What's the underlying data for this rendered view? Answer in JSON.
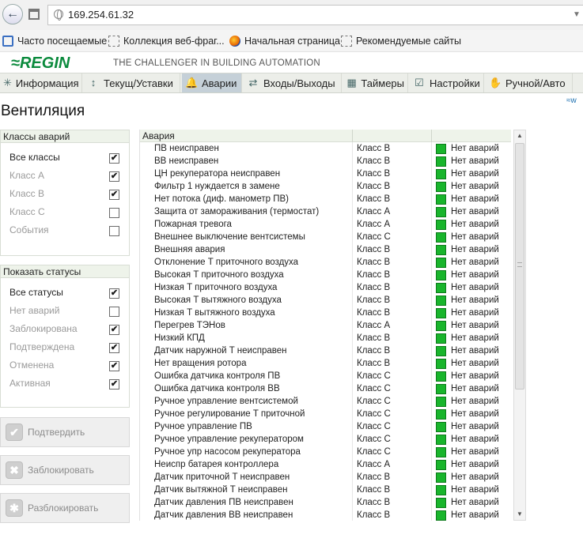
{
  "browser": {
    "url": "169.254.61.32",
    "bookmarks": [
      "Часто посещаемые",
      "Коллекция веб-фраг...",
      "Начальная страница",
      "Рекомендуемые сайты"
    ]
  },
  "app": {
    "logo": "REGIN",
    "tagline": "THE CHALLENGER IN BUILDING AUTOMATION",
    "corner_link": "w"
  },
  "menu": [
    {
      "label": "Информация",
      "icon": "snowflake-icon",
      "active": false
    },
    {
      "label": "Текущ/Уставки",
      "icon": "chart-icon",
      "active": false
    },
    {
      "label": "Аварии",
      "icon": "bell-icon",
      "active": true
    },
    {
      "label": "Входы/Выходы",
      "icon": "arrows-icon",
      "active": false
    },
    {
      "label": "Таймеры",
      "icon": "calendar-icon",
      "active": false
    },
    {
      "label": "Настройки",
      "icon": "checklist-icon",
      "active": false
    },
    {
      "label": "Ручной/Авто",
      "icon": "hand-icon",
      "active": false
    }
  ],
  "page_title": "Вентиляция",
  "alarm_classes": {
    "title": "Классы аварий",
    "options": [
      {
        "label": "Все классы",
        "checked": true,
        "dim": false
      },
      {
        "label": "Класс A",
        "checked": true,
        "dim": true
      },
      {
        "label": "Класс B",
        "checked": true,
        "dim": true
      },
      {
        "label": "Класс C",
        "checked": false,
        "dim": true
      },
      {
        "label": "События",
        "checked": false,
        "dim": true
      }
    ]
  },
  "statuses": {
    "title": "Показать статусы",
    "options": [
      {
        "label": "Все статусы",
        "checked": true,
        "dim": false
      },
      {
        "label": "Нет аварий",
        "checked": false,
        "dim": true
      },
      {
        "label": "Заблокирована",
        "checked": true,
        "dim": true
      },
      {
        "label": "Подтверждена",
        "checked": true,
        "dim": true
      },
      {
        "label": "Отменена",
        "checked": true,
        "dim": true
      },
      {
        "label": "Активная",
        "checked": true,
        "dim": true
      }
    ]
  },
  "actions": [
    {
      "label": "Подтвердить",
      "icon": "check-icon"
    },
    {
      "label": "Заблокировать",
      "icon": "block-icon"
    },
    {
      "label": "Разблокировать",
      "icon": "unblock-icon"
    }
  ],
  "table": {
    "header": "Авария",
    "status_color": "#19b52c",
    "rows": [
      {
        "name": "ПВ неисправен",
        "class": "Класс B",
        "status": "Нет аварий"
      },
      {
        "name": "ВВ неисправен",
        "class": "Класс B",
        "status": "Нет аварий"
      },
      {
        "name": "ЦН рекуператора неисправен",
        "class": "Класс B",
        "status": "Нет аварий"
      },
      {
        "name": "Фильтр 1 нуждается в замене",
        "class": "Класс B",
        "status": "Нет аварий"
      },
      {
        "name": "Нет потока (диф. манометр ПВ)",
        "class": "Класс B",
        "status": "Нет аварий"
      },
      {
        "name": "Защита от замораживания (термостат)",
        "class": "Класс A",
        "status": "Нет аварий"
      },
      {
        "name": "Пожарная тревога",
        "class": "Класс A",
        "status": "Нет аварий"
      },
      {
        "name": "Внешнее выключение вентсистемы",
        "class": "Класс C",
        "status": "Нет аварий"
      },
      {
        "name": "Внешняя авария",
        "class": "Класс B",
        "status": "Нет аварий"
      },
      {
        "name": "Отклонение T приточного воздуха",
        "class": "Класс B",
        "status": "Нет аварий"
      },
      {
        "name": "Высокая T приточного воздуха",
        "class": "Класс B",
        "status": "Нет аварий"
      },
      {
        "name": "Низкая T приточного воздуха",
        "class": "Класс B",
        "status": "Нет аварий"
      },
      {
        "name": "Высокая T вытяжного воздуха",
        "class": "Класс B",
        "status": "Нет аварий"
      },
      {
        "name": "Низкая T вытяжного воздуха",
        "class": "Класс B",
        "status": "Нет аварий"
      },
      {
        "name": "Перегрев ТЭНов",
        "class": "Класс A",
        "status": "Нет аварий"
      },
      {
        "name": "Низкий КПД",
        "class": "Класс B",
        "status": "Нет аварий"
      },
      {
        "name": "Датчик наружной T неисправен",
        "class": "Класс B",
        "status": "Нет аварий"
      },
      {
        "name": "Нет вращения ротора",
        "class": "Класс B",
        "status": "Нет аварий"
      },
      {
        "name": "Ошибка датчика контроля ПВ",
        "class": "Класс C",
        "status": "Нет аварий"
      },
      {
        "name": "Ошибка датчика контроля ВВ",
        "class": "Класс C",
        "status": "Нет аварий"
      },
      {
        "name": "Ручное управление вентсистемой",
        "class": "Класс C",
        "status": "Нет аварий"
      },
      {
        "name": "Ручное регулирование T приточной",
        "class": "Класс C",
        "status": "Нет аварий"
      },
      {
        "name": "Ручное управление ПВ",
        "class": "Класс C",
        "status": "Нет аварий"
      },
      {
        "name": "Ручное управление рекуператором",
        "class": "Класс C",
        "status": "Нет аварий"
      },
      {
        "name": "Ручное упр насосом рекуператора",
        "class": "Класс C",
        "status": "Нет аварий"
      },
      {
        "name": "Неиспр батарея контроллера",
        "class": "Класс A",
        "status": "Нет аварий"
      },
      {
        "name": "Датчик приточной T неисправен",
        "class": "Класс B",
        "status": "Нет аварий"
      },
      {
        "name": "Датчик вытяжной T неисправен",
        "class": "Класс B",
        "status": "Нет аварий"
      },
      {
        "name": "Датчик давления ПВ неисправен",
        "class": "Класс B",
        "status": "Нет аварий"
      },
      {
        "name": "Датчик давления ВВ неисправен",
        "class": "Класс B",
        "status": "Нет аварий"
      }
    ]
  }
}
